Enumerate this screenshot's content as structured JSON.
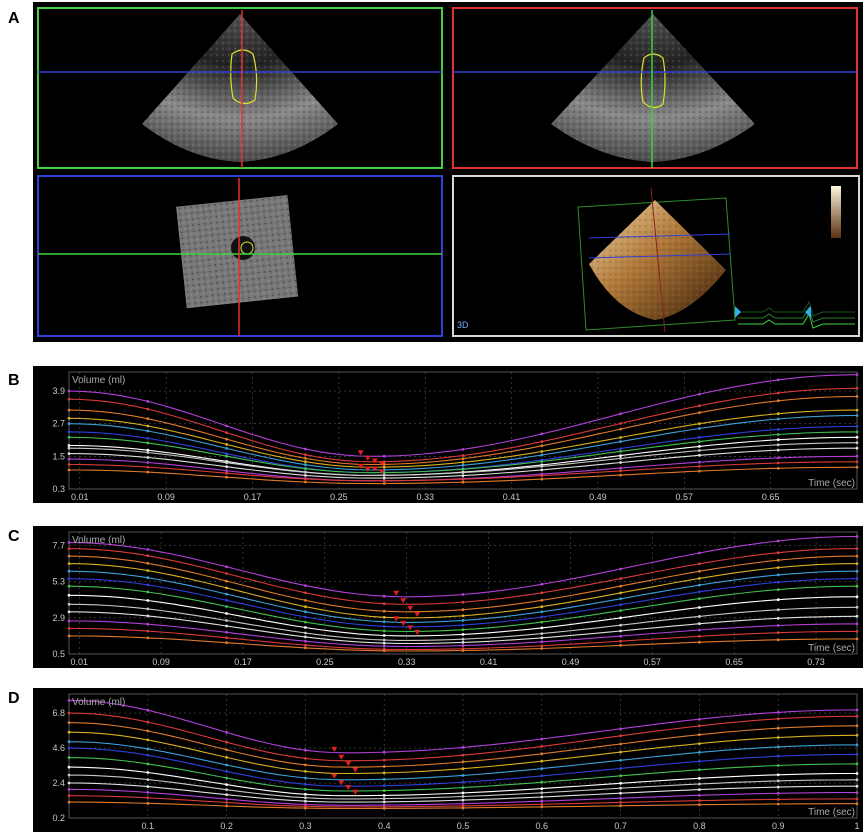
{
  "figure": {
    "panel_labels": [
      "A",
      "B",
      "C",
      "D"
    ]
  },
  "panel_a": {
    "badge_3d": "3D",
    "viewport_colors": [
      "#3fd43f",
      "#e23333",
      "#2f3fd8",
      "#d8d8d8"
    ]
  },
  "series_colors": [
    "#b040d8",
    "#d83a3a",
    "#e07a2a",
    "#d8b020",
    "#3aa0d8",
    "#2f3fd8",
    "#40c050",
    "#ffffff",
    "#c8c8c8",
    "#e0e0e0"
  ],
  "chart_data": [
    {
      "id": "B",
      "type": "line",
      "ylabel": "Volume (ml)",
      "xlabel": "Time (sec)",
      "y_ticks": [
        3.9,
        2.7,
        1.5,
        0.3
      ],
      "x_ticks": [
        0.01,
        0.09,
        0.17,
        0.25,
        0.33,
        0.41,
        0.49,
        0.57,
        0.65
      ],
      "xlim": [
        0.0,
        0.73
      ],
      "ylim": [
        0.3,
        4.6
      ],
      "min_time": 0.28,
      "series_ends": [
        4.5,
        4.0,
        3.7,
        3.2,
        3.0,
        2.6,
        2.4,
        2.2,
        2.0,
        1.8,
        1.5,
        1.3,
        1.1
      ],
      "series_mins": [
        1.5,
        1.3,
        1.2,
        1.1,
        1.0,
        0.9,
        0.9,
        0.8,
        0.8,
        0.7,
        0.6,
        0.6,
        0.5
      ],
      "series_starts": [
        3.9,
        3.6,
        3.2,
        2.9,
        2.7,
        2.4,
        2.2,
        1.9,
        1.8,
        1.6,
        1.4,
        1.2,
        1.0
      ]
    },
    {
      "id": "C",
      "type": "line",
      "ylabel": "Volume (ml)",
      "xlabel": "Time (sec)",
      "y_ticks": [
        7.7,
        5.3,
        2.9,
        0.5
      ],
      "x_ticks": [
        0.01,
        0.09,
        0.17,
        0.25,
        0.33,
        0.41,
        0.49,
        0.57,
        0.65,
        0.73
      ],
      "xlim": [
        0.0,
        0.77
      ],
      "ylim": [
        0.5,
        8.6
      ],
      "min_time": 0.33,
      "series_ends": [
        8.3,
        7.5,
        7.0,
        6.5,
        6.0,
        5.5,
        5.0,
        4.3,
        3.6,
        3.0,
        2.5,
        2.0,
        1.5
      ],
      "series_mins": [
        4.3,
        3.8,
        3.3,
        2.9,
        2.6,
        2.3,
        2.0,
        1.7,
        1.4,
        1.2,
        1.0,
        0.8,
        0.7
      ],
      "series_starts": [
        7.9,
        7.5,
        7.0,
        6.5,
        6.0,
        5.5,
        5.0,
        4.4,
        3.8,
        3.3,
        2.7,
        2.2,
        1.7
      ]
    },
    {
      "id": "D",
      "type": "line",
      "ylabel": "Volume (ml)",
      "xlabel": "Time (sec)",
      "y_ticks": [
        6.8,
        4.6,
        2.4,
        0.2
      ],
      "x_ticks": [
        0.1,
        0.2,
        0.3,
        0.4,
        0.5,
        0.6,
        0.7,
        0.8,
        0.9,
        1.0
      ],
      "xlim": [
        0.0,
        1.0
      ],
      "ylim": [
        0.2,
        8.0
      ],
      "min_time": 0.35,
      "series_ends": [
        7.0,
        6.6,
        6.0,
        5.4,
        4.8,
        4.2,
        3.6,
        3.0,
        2.6,
        2.2,
        1.8,
        1.4,
        1.1
      ],
      "series_mins": [
        4.3,
        3.8,
        3.4,
        3.0,
        2.6,
        2.2,
        1.9,
        1.6,
        1.4,
        1.2,
        1.0,
        0.9,
        0.8
      ],
      "series_starts": [
        7.6,
        6.8,
        6.2,
        5.6,
        5.0,
        4.6,
        4.0,
        3.4,
        2.9,
        2.4,
        2.0,
        1.6,
        1.2
      ]
    }
  ]
}
